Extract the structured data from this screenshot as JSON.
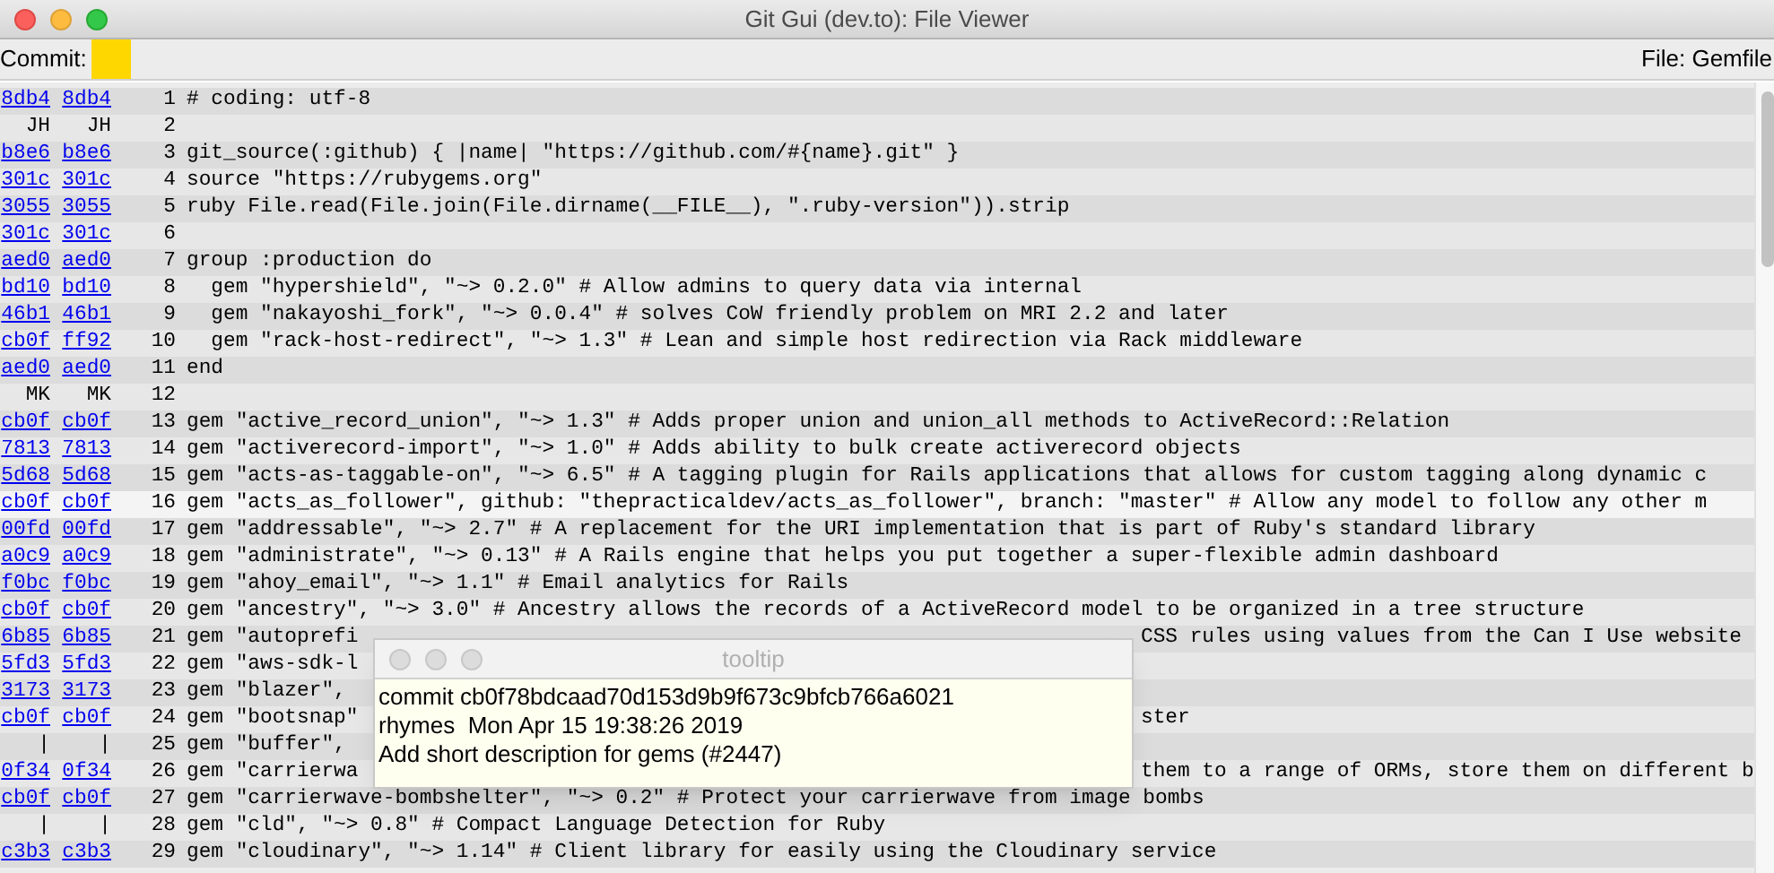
{
  "window": {
    "title": "Git Gui (dev.to): File Viewer"
  },
  "header": {
    "commit_label": "Commit:",
    "file_label": "File: Gemfile"
  },
  "lines": [
    {
      "orig": "8db4",
      "blame": "8db4",
      "link": true,
      "number": "1",
      "code": "# coding: utf-8",
      "selected": false
    },
    {
      "orig": "JH",
      "blame": "JH",
      "link": false,
      "number": "2",
      "selected": false
    },
    {
      "orig": "b8e6",
      "blame": "b8e6",
      "link": true,
      "number": "3",
      "code": "git_source(:github) { |name| \"https://github.com/#{name}.git\" }",
      "selected": false
    },
    {
      "orig": "301c",
      "blame": "301c",
      "link": true,
      "number": "4",
      "code": "source \"https://rubygems.org\"",
      "selected": false
    },
    {
      "orig": "3055",
      "blame": "3055",
      "link": true,
      "number": "5",
      "code": "ruby File.read(File.join(File.dirname(__FILE__), \".ruby-version\")).strip",
      "selected": false
    },
    {
      "orig": "301c",
      "blame": "301c",
      "link": true,
      "number": "6",
      "selected": false
    },
    {
      "orig": "aed0",
      "blame": "aed0",
      "link": true,
      "number": "7",
      "code": "group :production do",
      "selected": false
    },
    {
      "orig": "bd10",
      "blame": "bd10",
      "link": true,
      "number": "8",
      "code": "  gem \"hypershield\", \"~> 0.2.0\" # Allow admins to query data via internal",
      "selected": false
    },
    {
      "orig": "46b1",
      "blame": "46b1",
      "link": true,
      "number": "9",
      "code": "  gem \"nakayoshi_fork\", \"~> 0.0.4\" # solves CoW friendly problem on MRI 2.2 and later",
      "selected": false
    },
    {
      "orig": "cb0f",
      "blame": "ff92",
      "link": true,
      "number": "10",
      "code": "  gem \"rack-host-redirect\", \"~> 1.3\" # Lean and simple host redirection via Rack middleware",
      "selected": false
    },
    {
      "orig": "aed0",
      "blame": "aed0",
      "link": true,
      "number": "11",
      "code": "end",
      "selected": false
    },
    {
      "orig": "MK",
      "blame": "MK",
      "link": false,
      "number": "12",
      "selected": false
    },
    {
      "orig": "cb0f",
      "blame": "cb0f",
      "link": true,
      "number": "13",
      "code": "gem \"active_record_union\", \"~> 1.3\" # Adds proper union and union_all methods to ActiveRecord::Relation",
      "selected": false
    },
    {
      "orig": "7813",
      "blame": "7813",
      "link": true,
      "number": "14",
      "code": "gem \"activerecord-import\", \"~> 1.0\" # Adds ability to bulk create activerecord objects",
      "selected": false
    },
    {
      "orig": "5d68",
      "blame": "5d68",
      "link": true,
      "number": "15",
      "code": "gem \"acts-as-taggable-on\", \"~> 6.5\" # A tagging plugin for Rails applications that allows for custom tagging along dynamic c",
      "selected": false
    },
    {
      "orig": "cb0f",
      "blame": "cb0f",
      "link": true,
      "number": "16",
      "code": "gem \"acts_as_follower\", github: \"thepracticaldev/acts_as_follower\", branch: \"master\" # Allow any model to follow any other m",
      "selected": true
    },
    {
      "orig": "00fd",
      "blame": "00fd",
      "link": true,
      "number": "17",
      "code": "gem \"addressable\", \"~> 2.7\" # A replacement for the URI implementation that is part of Ruby's standard library",
      "selected": false
    },
    {
      "orig": "a0c9",
      "blame": "a0c9",
      "link": true,
      "number": "18",
      "code": "gem \"administrate\", \"~> 0.13\" # A Rails engine that helps you put together a super-flexible admin dashboard",
      "selected": false
    },
    {
      "orig": "f0bc",
      "blame": "f0bc",
      "link": true,
      "number": "19",
      "code": "gem \"ahoy_email\", \"~> 1.1\" # Email analytics for Rails",
      "selected": false
    },
    {
      "orig": "cb0f",
      "blame": "cb0f",
      "link": true,
      "number": "20",
      "code": "gem \"ancestry\", \"~> 3.0\" # Ancestry allows the records of a ActiveRecord model to be organized in a tree structure",
      "selected": false
    },
    {
      "orig": "6b85",
      "blame": "6b85",
      "link": true,
      "number": "21",
      "code": "gem \"autoprefi",
      "code_right": "CSS rules using values from the Can I Use website",
      "selected": false
    },
    {
      "orig": "5fd3",
      "blame": "5fd3",
      "link": true,
      "number": "22",
      "code": "gem \"aws-sdk-l",
      "selected": false
    },
    {
      "orig": "3173",
      "blame": "3173",
      "link": true,
      "number": "23",
      "code": "gem \"blazer\",",
      "selected": false
    },
    {
      "orig": "cb0f",
      "blame": "cb0f",
      "link": true,
      "number": "24",
      "code": "gem \"bootsnap\"",
      "code_right": "ster",
      "selected": false
    },
    {
      "orig": "|",
      "blame": "|",
      "link": false,
      "number": "25",
      "code": "gem \"buffer\",",
      "selected": false
    },
    {
      "orig": "0f34",
      "blame": "0f34",
      "link": true,
      "number": "26",
      "code": "gem \"carrierwa",
      "code_right": "them to a range of ORMs, store them on different b",
      "selected": false
    },
    {
      "orig": "cb0f",
      "blame": "cb0f",
      "link": true,
      "number": "27",
      "code": "gem \"carrierwave-bombshelter\", \"~> 0.2\" # Protect your carrierwave from image bombs",
      "selected": false
    },
    {
      "orig": "|",
      "blame": "|",
      "link": false,
      "number": "28",
      "code": "gem \"cld\", \"~> 0.8\" # Compact Language Detection for Ruby",
      "selected": false
    },
    {
      "orig": "c3b3",
      "blame": "c3b3",
      "link": true,
      "number": "29",
      "code": "gem \"cloudinary\", \"~> 1.14\" # Client library for easily using the Cloudinary service",
      "selected": false
    }
  ],
  "tooltip": {
    "title": "tooltip",
    "lines": [
      "commit cb0f78bdcaad70d153d9b9f673c9bfcb766a6021",
      "rhymes  Mon Apr 15 19:38:26 2019",
      "Add short description for gems (#2447)"
    ]
  }
}
